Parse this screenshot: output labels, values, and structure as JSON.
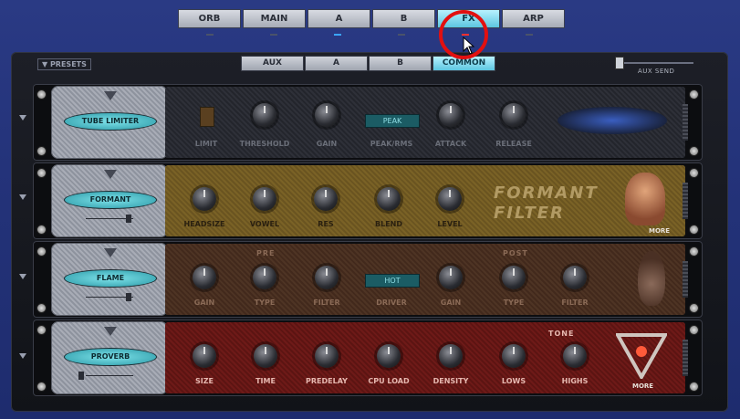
{
  "tabs": [
    {
      "label": "ORB",
      "active": false
    },
    {
      "label": "MAIN",
      "active": false
    },
    {
      "label": "A",
      "active": false
    },
    {
      "label": "B",
      "active": false
    },
    {
      "label": "FX",
      "active": true
    },
    {
      "label": "ARP",
      "active": false
    }
  ],
  "presets_label": "PRESETS",
  "subtabs": [
    {
      "label": "AUX",
      "active": false
    },
    {
      "label": "A",
      "active": false
    },
    {
      "label": "B",
      "active": false
    },
    {
      "label": "COMMON",
      "active": true
    }
  ],
  "aux_send_label": "AUX SEND",
  "slots": [
    {
      "name": "TUBE LIMITER",
      "controls": [
        "LIMIT",
        "THRESHOLD",
        "GAIN",
        "PEAK/RMS",
        "ATTACK",
        "RELEASE"
      ],
      "display": "PEAK"
    },
    {
      "name": "FORMANT",
      "controls": [
        "HEADSIZE",
        "VOWEL",
        "RES",
        "BLEND",
        "LEVEL"
      ],
      "title_line1": "FORMANT",
      "title_line2": "FILTER",
      "more": "MORE"
    },
    {
      "name": "FLAME",
      "pre_label": "PRE",
      "post_label": "POST",
      "controls": [
        "GAIN",
        "TYPE",
        "FILTER",
        "DRIVER",
        "GAIN",
        "TYPE",
        "FILTER"
      ],
      "display": "HOT"
    },
    {
      "name": "PROVERB",
      "tone_label": "TONE",
      "controls": [
        "SIZE",
        "TIME",
        "PREDELAY",
        "CPU LOAD",
        "DENSITY",
        "LOWS",
        "HIGHS"
      ],
      "more": "MORE"
    }
  ]
}
